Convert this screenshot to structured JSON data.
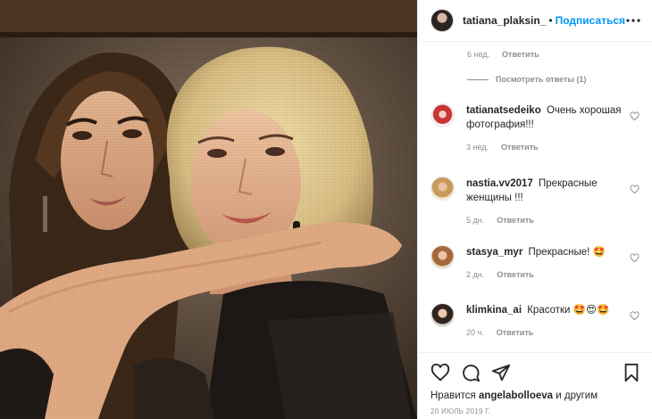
{
  "post": {
    "author": "tatiana_plaksin_",
    "separator": "•",
    "follow_label": "Подписаться",
    "image_alt": "Cross-stitch portrait of two women embracing"
  },
  "first_comment_meta": {
    "time": "6 нед.",
    "reply_label": "Ответить"
  },
  "view_replies_label": "Посмотреть ответы (1)",
  "comments": [
    {
      "username": "tatianatsedeiko",
      "text": "Очень хорошая фотография!!!",
      "time": "3 нед.",
      "reply_label": "Ответить"
    },
    {
      "username": "nastia.vv2017",
      "text": "Прекрасные женщины !!!",
      "time": "5 дн.",
      "reply_label": "Ответить"
    },
    {
      "username": "stasya_myr",
      "text": "Прекрасные! 🤩",
      "time": "2 дн.",
      "reply_label": "Ответить"
    },
    {
      "username": "klimkina_ai",
      "text": "Красотки 🤩😍🤩",
      "time": "20 ч.",
      "reply_label": "Ответить"
    }
  ],
  "likes": {
    "prefix": "Нравится",
    "user": "angelabolloeva",
    "suffix": "и другим"
  },
  "date": "20 июль 2019 г.",
  "colors": {
    "link_blue": "#0095f6",
    "meta_gray": "#8e8e8e",
    "text": "#262626",
    "divider": "#efefef"
  },
  "icons": {
    "more": "more-dots-icon",
    "like": "heart-icon",
    "comment": "comment-bubble-icon",
    "share": "paper-plane-icon",
    "save": "bookmark-icon"
  }
}
